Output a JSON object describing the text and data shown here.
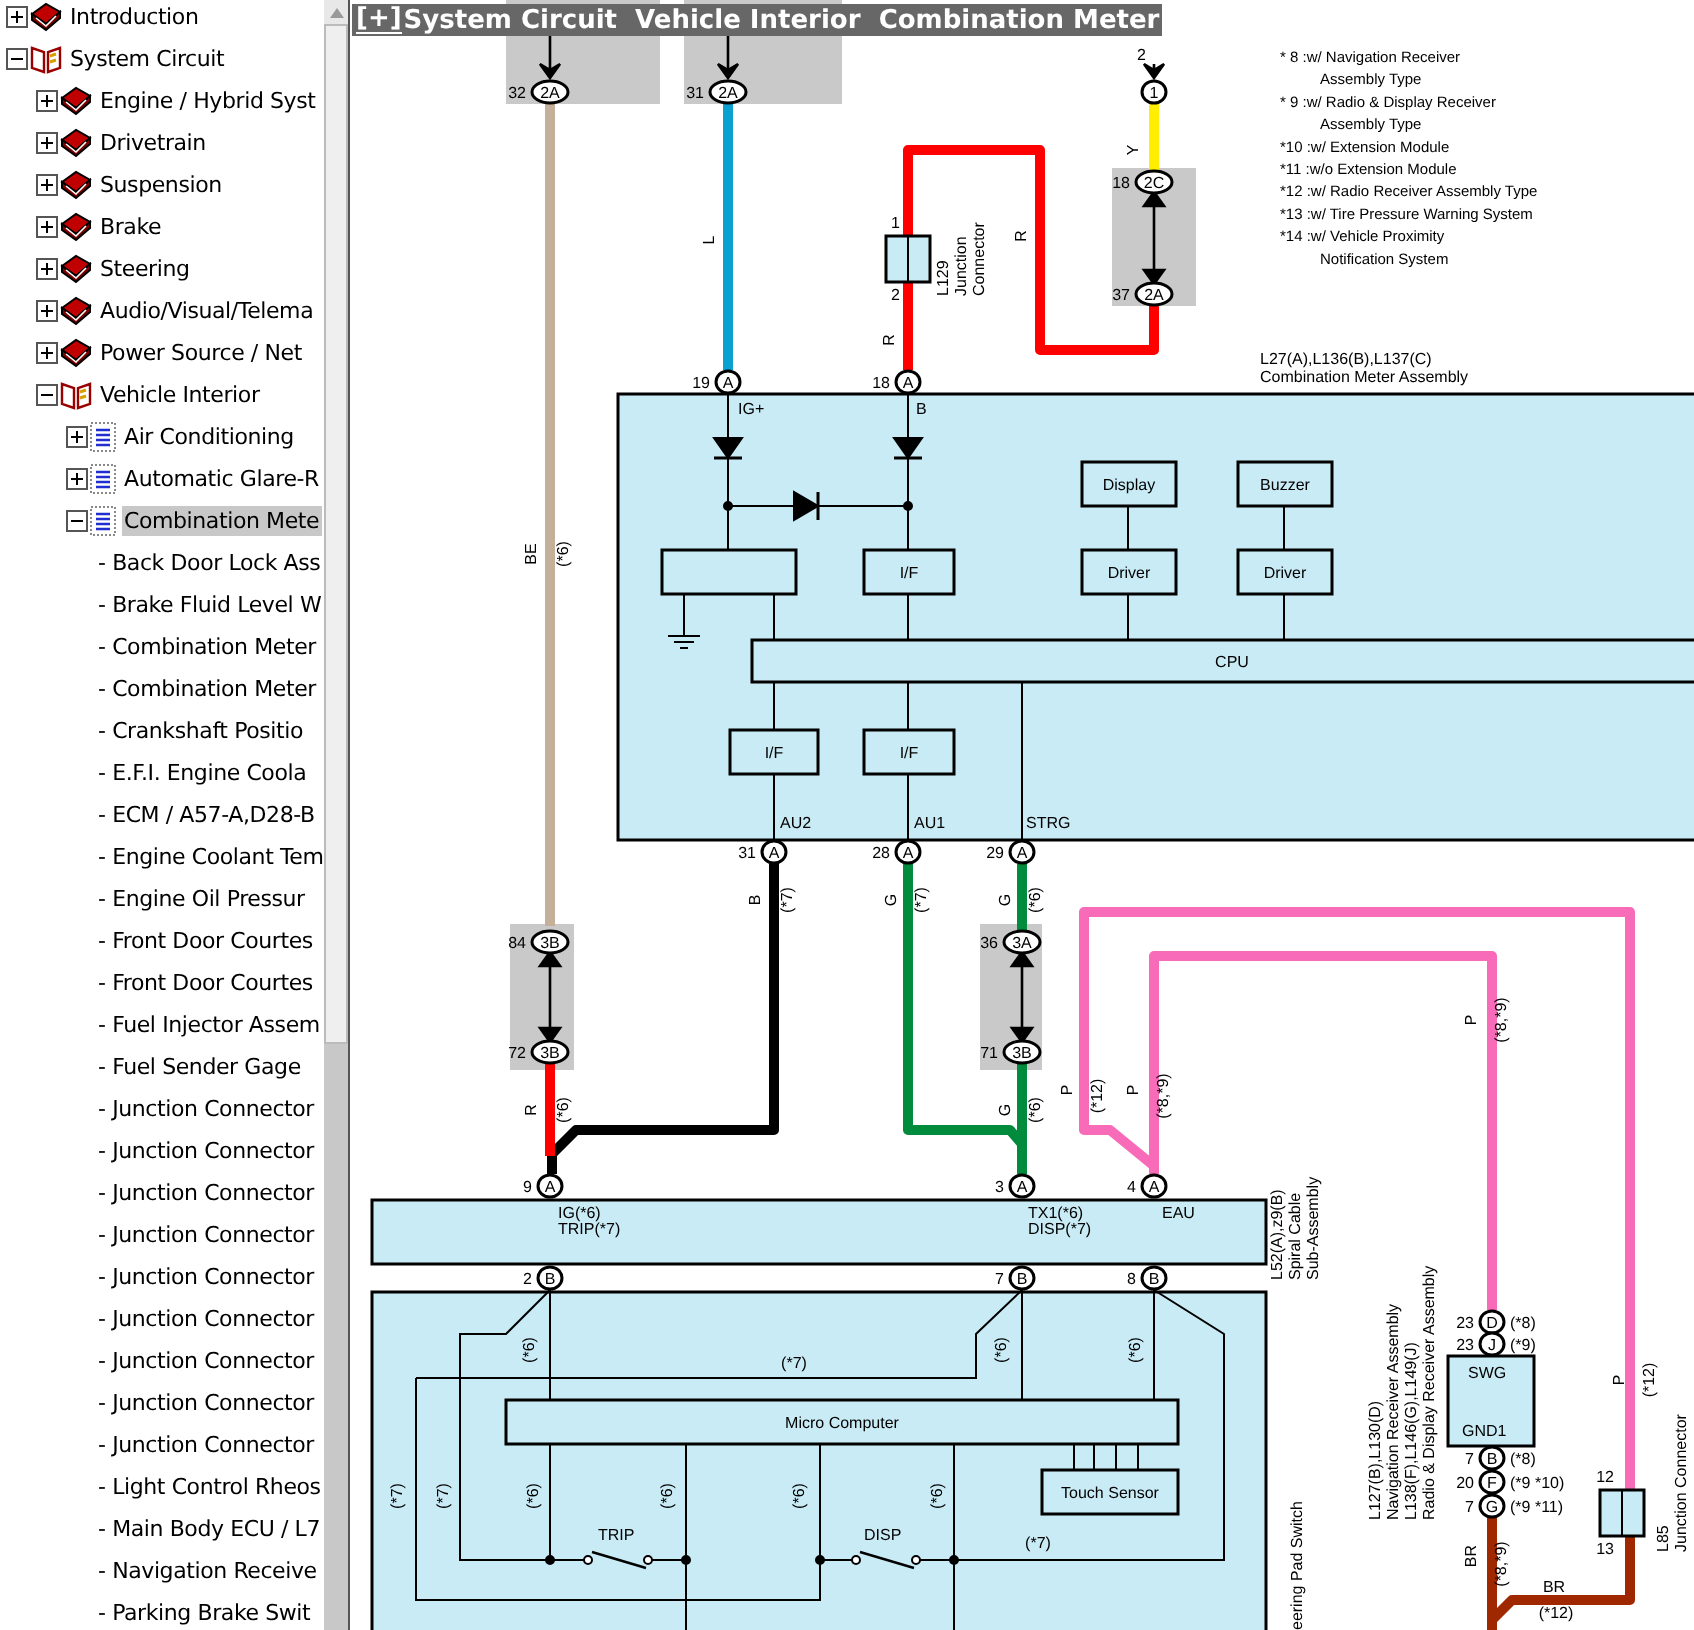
{
  "tree": [
    {
      "label": "Introduction",
      "kind": "book",
      "expanded": false,
      "selected": false
    },
    {
      "label": "System Circuit",
      "kind": "open-book",
      "expanded": true,
      "selected": false,
      "children": [
        {
          "label": "Engine / Hybrid Syst",
          "kind": "book",
          "expanded": false,
          "selected": false
        },
        {
          "label": "Drivetrain",
          "kind": "book",
          "expanded": false,
          "selected": false
        },
        {
          "label": "Suspension",
          "kind": "book",
          "expanded": false,
          "selected": false
        },
        {
          "label": "Brake",
          "kind": "book",
          "expanded": false,
          "selected": false
        },
        {
          "label": "Steering",
          "kind": "book",
          "expanded": false,
          "selected": false
        },
        {
          "label": "Audio/Visual/Telema",
          "kind": "book",
          "expanded": false,
          "selected": false
        },
        {
          "label": "Power Source / Net",
          "kind": "book",
          "expanded": false,
          "selected": false
        },
        {
          "label": "Vehicle Interior",
          "kind": "open-book",
          "expanded": true,
          "selected": false,
          "children": [
            {
              "label": "Air Conditioning",
              "kind": "page",
              "expanded": false,
              "selected": false
            },
            {
              "label": "Automatic Glare-R",
              "kind": "page",
              "expanded": false,
              "selected": false
            },
            {
              "label": "Combination Mete",
              "kind": "page",
              "expanded": true,
              "selected": true,
              "children": [
                {
                  "label": "- Back Door Lock Ass",
                  "kind": "leaf",
                  "selected": false
                },
                {
                  "label": "- Brake Fluid Level W",
                  "kind": "leaf",
                  "selected": false
                },
                {
                  "label": "- Combination Meter",
                  "kind": "leaf",
                  "selected": false
                },
                {
                  "label": "- Combination Meter",
                  "kind": "leaf",
                  "selected": false
                },
                {
                  "label": "- Crankshaft Positio",
                  "kind": "leaf",
                  "selected": false
                },
                {
                  "label": "- E.F.I. Engine Coola",
                  "kind": "leaf",
                  "selected": false
                },
                {
                  "label": "- ECM / A57-A,D28-B",
                  "kind": "leaf",
                  "selected": false
                },
                {
                  "label": "- Engine Coolant Tem",
                  "kind": "leaf",
                  "selected": false
                },
                {
                  "label": "- Engine Oil Pressur",
                  "kind": "leaf",
                  "selected": false
                },
                {
                  "label": "- Front Door Courtes",
                  "kind": "leaf",
                  "selected": false
                },
                {
                  "label": "- Front Door Courtes",
                  "kind": "leaf",
                  "selected": false
                },
                {
                  "label": "- Fuel Injector Assem",
                  "kind": "leaf",
                  "selected": false
                },
                {
                  "label": "- Fuel Sender Gage",
                  "kind": "leaf",
                  "selected": false
                },
                {
                  "label": "- Junction Connector",
                  "kind": "leaf",
                  "selected": false
                },
                {
                  "label": "- Junction Connector",
                  "kind": "leaf",
                  "selected": false
                },
                {
                  "label": "- Junction Connector",
                  "kind": "leaf",
                  "selected": false
                },
                {
                  "label": "- Junction Connector",
                  "kind": "leaf",
                  "selected": false
                },
                {
                  "label": "- Junction Connector",
                  "kind": "leaf",
                  "selected": false
                },
                {
                  "label": "- Junction Connector",
                  "kind": "leaf",
                  "selected": false
                },
                {
                  "label": "- Junction Connector",
                  "kind": "leaf",
                  "selected": false
                },
                {
                  "label": "- Junction Connector",
                  "kind": "leaf",
                  "selected": false
                },
                {
                  "label": "- Junction Connector",
                  "kind": "leaf",
                  "selected": false
                },
                {
                  "label": "- Light Control Rheos",
                  "kind": "leaf",
                  "selected": false
                },
                {
                  "label": "- Main Body ECU / L7",
                  "kind": "leaf",
                  "selected": false
                },
                {
                  "label": "- Navigation Receive",
                  "kind": "leaf",
                  "selected": false
                },
                {
                  "label": "- Parking Brake Swit",
                  "kind": "leaf",
                  "selected": false
                }
              ]
            }
          ]
        }
      ]
    }
  ],
  "diagram": {
    "toggle": "[+]",
    "title": "System Circuit  Vehicle Interior  Combination Meter",
    "notes": [
      "* 8 :w/ Navigation Receiver",
      "Assembly Type",
      "* 9 :w/ Radio & Display Receiver",
      "Assembly Type",
      "*10 :w/ Extension Module",
      "*11 :w/o Extension Module",
      "*12 :w/ Radio Receiver Assembly Type",
      "*13 :w/ Tire Pressure Warning System",
      "*14 :w/ Vehicle Proximity",
      "Notification System"
    ],
    "wires": [
      {
        "color": "#c4b09a"
      },
      {
        "color": "#0aa0d0"
      },
      {
        "color": "#ff0000"
      },
      {
        "color": "#ffee00"
      },
      {
        "color": "#000000"
      },
      {
        "color": "#ff0000"
      },
      {
        "color": "#008c3c"
      },
      {
        "color": "#008c3c"
      },
      {
        "color": "#f76bb8"
      },
      {
        "color": "#f76bb8"
      },
      {
        "color": "#a02800"
      }
    ],
    "connectors": [
      {
        "pin": "32",
        "code": "2A"
      },
      {
        "pin": "31",
        "code": "2A"
      },
      {
        "pin": "2",
        "code": "1"
      },
      {
        "pin": "18",
        "code": "2C"
      },
      {
        "pin": "37",
        "code": "2A"
      },
      {
        "pin": "19",
        "code": "A"
      },
      {
        "pin": "18",
        "code": "A"
      },
      {
        "pin": "31",
        "code": "A"
      },
      {
        "pin": "28",
        "code": "A"
      },
      {
        "pin": "29",
        "code": "A"
      },
      {
        "pin": "84",
        "code": "3B"
      },
      {
        "pin": "72",
        "code": "3B"
      },
      {
        "pin": "36",
        "code": "3A"
      },
      {
        "pin": "71",
        "code": "3B"
      },
      {
        "pin": "9",
        "code": "A"
      },
      {
        "pin": "3",
        "code": "A"
      },
      {
        "pin": "4",
        "code": "A"
      },
      {
        "pin": "2",
        "code": "B"
      },
      {
        "pin": "7",
        "code": "B"
      },
      {
        "pin": "8",
        "code": "B"
      },
      {
        "pin": "23",
        "code": "D",
        "note": "(*8)"
      },
      {
        "pin": "23",
        "code": "J",
        "note": "(*9)"
      },
      {
        "pin": "7",
        "code": "B",
        "note": "(*8)"
      },
      {
        "pin": "20",
        "code": "F",
        "note": "(*9 *10)"
      },
      {
        "pin": "7",
        "code": "G",
        "note": "(*9 *11)"
      }
    ],
    "junctions": [
      {
        "pins": [
          "1",
          "2"
        ]
      },
      {
        "pins": [
          "12",
          "13"
        ]
      }
    ],
    "wire_marks": [
      "BE",
      "(*6)",
      "L",
      "R",
      "R",
      "Y",
      "B",
      "(*7)",
      "G",
      "(*7)",
      "G",
      "(*6)",
      "R",
      "(*6)",
      "G",
      "(*6)",
      "P",
      "(*12)",
      "P",
      "(*8,*9)",
      "P",
      "(*8,*9)",
      "P",
      "(*12)",
      "BR",
      "(*8,*9)",
      "(*6)",
      "(*6)",
      "(*6)",
      "(*7)",
      "(*7)",
      "(*6)",
      "(*6)",
      "(*6)",
      "(*6)"
    ],
    "flat_marks": [
      "BR",
      "(*12)",
      "(*7)",
      "(*7)"
    ],
    "blocks": [
      "Display",
      "Buzzer",
      "Driver",
      "Driver",
      "I/F",
      "I/F",
      "I/F",
      "CPU",
      "Micro Computer",
      "Touch Sensor"
    ],
    "terminals": [
      "IG+",
      "B",
      "AU2",
      "AU1",
      "STRG",
      "IG(*6)",
      "TRIP(*7)",
      "TX1(*6)",
      "DISP(*7)",
      "EAU",
      "TRIP",
      "DISP",
      "SWG",
      "GND1"
    ],
    "components": [
      {
        "lines": [
          "L129",
          "Junction",
          "Connector"
        ]
      },
      {
        "lines": [
          "L27(A),L136(B),L137(C)",
          "Combination Meter Assembly"
        ]
      },
      {
        "lines": [
          "L52(A),z9(B)",
          "Spiral Cable",
          "Sub-Assembly"
        ]
      },
      {
        "lines": [
          "L127(B),L130(D)",
          "Navigation Receiver Assembly",
          "L138(F),L146(G),L149(J)",
          "Radio & Display Receiver Assembly"
        ]
      },
      {
        "lines": [
          "L85",
          "Junction Connector"
        ]
      },
      {
        "lines": [
          "eering Pad Switch"
        ]
      }
    ]
  }
}
